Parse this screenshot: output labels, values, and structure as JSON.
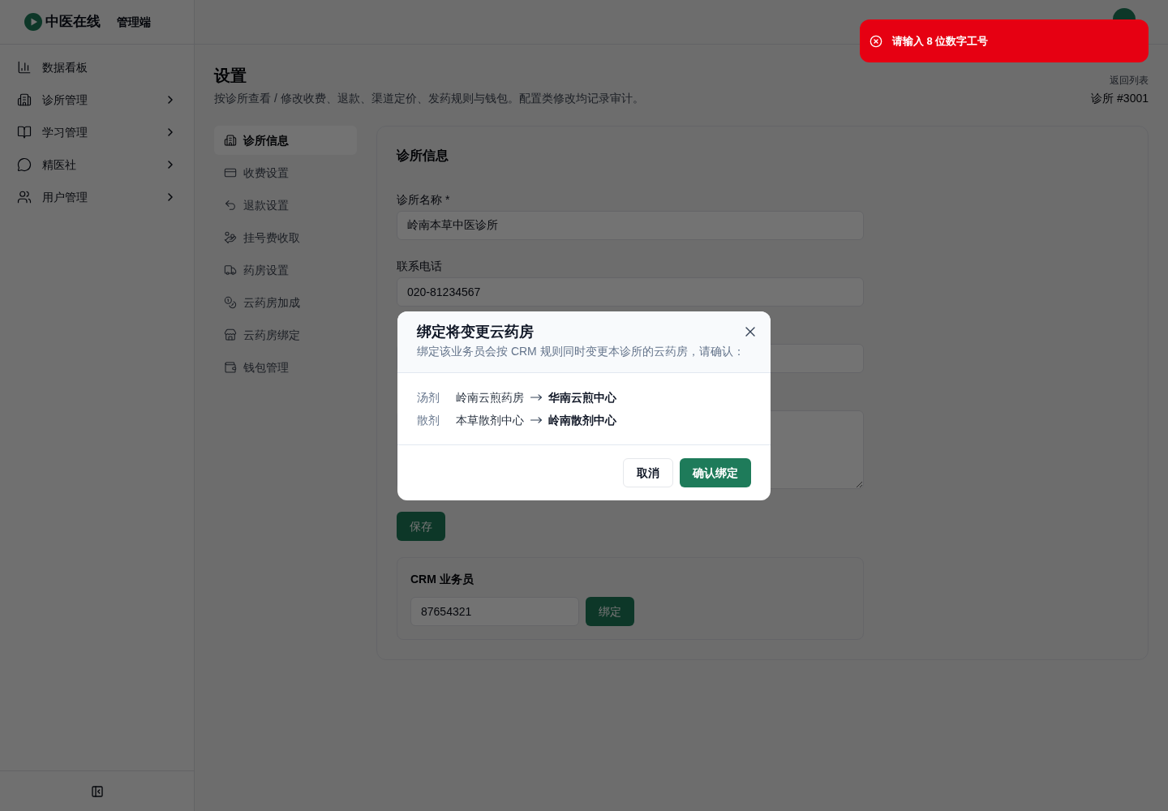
{
  "sidebar": {
    "logo": {
      "name": "中医在线",
      "suffix": "管理端"
    },
    "items": [
      {
        "label": "数据看板",
        "kind": "link"
      },
      {
        "label": "诊所管理",
        "kind": "group"
      },
      {
        "label": "学习管理",
        "kind": "group"
      },
      {
        "label": "精医社",
        "kind": "group"
      },
      {
        "label": "用户管理",
        "kind": "group"
      }
    ]
  },
  "page": {
    "title": "设置",
    "subtitle": "按诊所查看 / 修改收费、退款、渠道定价、发药规则与钱包。配置类修改均记录审计。",
    "back_link": "返回列表",
    "clinic_id": "诊所 #3001"
  },
  "settings_nav": [
    {
      "label": "诊所信息",
      "selected": true
    },
    {
      "label": "收费设置",
      "selected": false
    },
    {
      "label": "退款设置",
      "selected": false
    },
    {
      "label": "挂号费收取",
      "selected": false
    },
    {
      "label": "药房设置",
      "selected": false
    },
    {
      "label": "云药房加成",
      "selected": false
    },
    {
      "label": "云药房绑定",
      "selected": false
    },
    {
      "label": "钱包管理",
      "selected": false
    }
  ],
  "clinic_form": {
    "title": "诊所信息",
    "fields": [
      {
        "kind": "input",
        "label": "诊所名称 *",
        "value": "岭南本草中医诊所"
      },
      {
        "kind": "input",
        "label": "联系电话",
        "value": "020-81234567"
      },
      {
        "kind": "input"
      },
      {
        "kind": "textarea"
      }
    ],
    "save_button": "保存",
    "crm": {
      "title": "CRM 业务员",
      "value": "87654321",
      "button": "绑定"
    }
  },
  "dialog": {
    "title": "绑定将变更云药房",
    "description": "绑定该业务员会按 CRM 规则同时变更本诊所的云药房，请确认：",
    "changes": [
      {
        "type": "汤剂",
        "from": "岭南云煎药房",
        "to": "华南云煎中心"
      },
      {
        "type": "散剂",
        "from": "本草散剂中心",
        "to": "岭南散剂中心"
      }
    ],
    "buttons": [
      {
        "label": "取消",
        "kind": "secondary"
      },
      {
        "label": "确认绑定",
        "kind": "primary"
      }
    ]
  },
  "toast": {
    "kind": "error",
    "message": "请输入 8 位数字工号"
  }
}
